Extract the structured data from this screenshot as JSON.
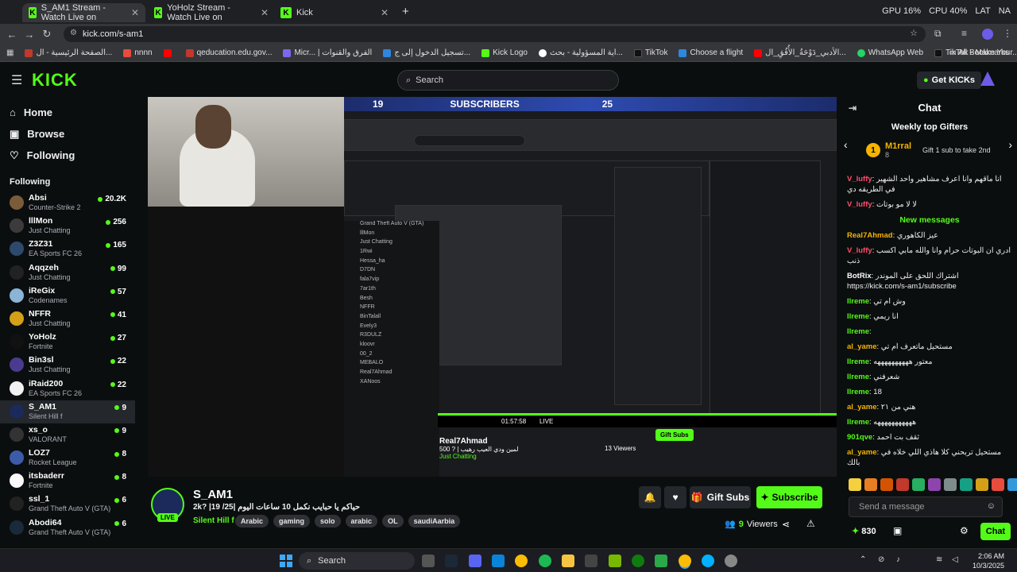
{
  "browser": {
    "tabs": [
      {
        "title": "S_AM1 Stream - Watch Live on",
        "active": true
      },
      {
        "title": "YoHolz Stream - Watch Live on",
        "active": false
      },
      {
        "title": "Kick",
        "active": false
      }
    ],
    "new_tab": "+",
    "stats": {
      "gpu": "GPU 16%",
      "cpu": "CPU 40%",
      "lang": "LAT",
      "net": "NA"
    },
    "url": "kick.com/s-am1",
    "bookmarks": [
      {
        "label": "الصفحة الرئيسية - ال...",
        "color": "#c0392b"
      },
      {
        "label": "nnnn",
        "color": "#e74c3c"
      },
      {
        "label": "",
        "color": "#ff0000"
      },
      {
        "label": "qeducation.edu.gov...",
        "color": "#c0392b"
      },
      {
        "label": "Micr... | الفرق والقنوات",
        "color": "#7b68ee"
      },
      {
        "label": "تسجيل الدخول إلى ج...",
        "color": "#2e86de"
      },
      {
        "label": "Kick Logo",
        "color": "#53fc18"
      },
      {
        "label": "اية المسؤولية - بحث...",
        "color": "#ffffff"
      },
      {
        "label": "TikTok",
        "color": "#111111"
      },
      {
        "label": "Choose a flight",
        "color": "#2e86de"
      },
      {
        "label": "الأدبي_دَوْحَةُ_الأُفُقِ_ال...",
        "color": "#ff0000"
      },
      {
        "label": "WhatsApp Web",
        "color": "#25d366"
      },
      {
        "label": "TikTok - Make Your...",
        "color": "#111111"
      },
      {
        "label": "",
        "color": "#ff0000"
      }
    ],
    "all_bookmarks": "All Bookmarks"
  },
  "kick": {
    "logo": "KICK",
    "search_placeholder": "Search",
    "get_kicks": "Get KICKs"
  },
  "sidebar": {
    "nav": [
      {
        "label": "Home",
        "icon": "home-icon"
      },
      {
        "label": "Browse",
        "icon": "browse-icon"
      },
      {
        "label": "Following",
        "icon": "heart-icon"
      }
    ],
    "following_title": "Following",
    "channels": [
      {
        "name": "Absi",
        "game": "Counter-Strike 2",
        "viewers": "20.2K",
        "color": "#7a5c3a"
      },
      {
        "name": "lllMon",
        "game": "Just Chatting",
        "viewers": "256",
        "color": "#3b3b3b"
      },
      {
        "name": "Z3Z31",
        "game": "EA Sports FC 26",
        "viewers": "165",
        "color": "#2d4a6d"
      },
      {
        "name": "Aqqzeh",
        "game": "Just Chatting",
        "viewers": "99",
        "color": "#222"
      },
      {
        "name": "iReGix",
        "game": "Codenames",
        "viewers": "57",
        "color": "#8ab4d8"
      },
      {
        "name": "NFFR",
        "game": "Just Chatting",
        "viewers": "41",
        "color": "#d4a017"
      },
      {
        "name": "YoHolz",
        "game": "Fortnite",
        "viewers": "27",
        "color": "#111"
      },
      {
        "name": "Bin3sl",
        "game": "Just Chatting",
        "viewers": "22",
        "color": "#4a3b8f"
      },
      {
        "name": "iRaid200",
        "game": "EA Sports FC 26",
        "viewers": "22",
        "color": "#f2f2f2"
      },
      {
        "name": "S_AM1",
        "game": "Silent Hill f",
        "viewers": "9",
        "color": "#1b2a5a",
        "selected": true
      },
      {
        "name": "xs_o",
        "game": "VALORANT",
        "viewers": "9",
        "color": "#333"
      },
      {
        "name": "LOZ7",
        "game": "Rocket League",
        "viewers": "8",
        "color": "#3c5ba8"
      },
      {
        "name": "itsbaderr",
        "game": "Fortnite",
        "viewers": "8",
        "color": "#fafafa"
      },
      {
        "name": "ssl_1",
        "game": "Grand Theft Auto V (GTA)",
        "viewers": "6",
        "color": "#222"
      },
      {
        "name": "Abodi64",
        "game": "Grand Theft Auto V (GTA)",
        "viewers": "6",
        "color": "#1a2a3a"
      }
    ]
  },
  "video": {
    "sub_banner_left": "19",
    "sub_banner_title": "SUBSCRIBERS",
    "sub_banner_right": "25",
    "inner_list": [
      "Grand Theft Auto V (GTA)",
      "lllMon",
      "Just Chatting",
      "1Rwi",
      "Hessa_ha",
      "D7DN",
      "fala7vip",
      "7ar1th",
      "Besh",
      "NFFR",
      "BinTalall",
      "Evely3",
      "R3DULZ",
      "kloovr",
      "00_2",
      "MEBALO",
      "Real7Ahmad",
      "XANoos"
    ],
    "inner_streamer": "Real7Ahmad",
    "inner_title": "500 ? | لمين ودي العيب رهيب",
    "inner_game": "Just Chatting",
    "inner_viewers": "13 Viewers",
    "inner_time": "01:57:58",
    "inner_live": "LIVE",
    "inner_gift": "Gift Subs"
  },
  "stream": {
    "channel": "S_AM1",
    "title": "2k? |19 /25| حياكم يا حبايب نكمل 10 ساعات اليوم",
    "game": "Silent Hill f",
    "live": "LIVE",
    "tags": [
      "Arabic",
      "gaming",
      "solo",
      "arabic",
      "OL",
      "saudiAarbia"
    ],
    "gift_subs": "Gift Subs",
    "subscribe": "Subscribe",
    "viewers_count": "9",
    "viewers_label": "Viewers"
  },
  "chat": {
    "title": "Chat",
    "weekly_title": "Weekly top Gifters",
    "top_gifter": {
      "rank": "1",
      "name": "M1rral",
      "count": "8"
    },
    "gift_prompt": "Gift 1 sub to take 2nd",
    "messages_top": [
      {
        "user": "V_luffy",
        "text": "انا ماقهم وانا اعرف مشاهير واحد الشهير في الطريقه دي",
        "color": "#ff4d6d"
      },
      {
        "user": "V_luffy",
        "text": "لا لا مو بوتات",
        "color": "#ff4d6d"
      }
    ],
    "new_messages": "New messages",
    "messages": [
      {
        "user": "Real7Ahmad",
        "text": "عيز الكاهوري",
        "color": "#f4b400"
      },
      {
        "user": "V_luffy",
        "text": "ادري ان البوتات حرام وانا والله مابي اكسب ذنب",
        "color": "#ff4d6d"
      },
      {
        "user": "BotRix",
        "text": "اشتراك اللحق على الموندر https://kick.com/s-am1/subscribe",
        "color": "#ffffff"
      },
      {
        "user": "llreme",
        "text": "وش ام تي",
        "color": "#53fc18"
      },
      {
        "user": "llreme",
        "text": "انا ريمي",
        "color": "#53fc18"
      },
      {
        "user": "llreme",
        "text": "",
        "color": "#53fc18"
      },
      {
        "user": "al_yame",
        "text": "مستحيل ماتعرف ام تي",
        "color": "#f4b400"
      },
      {
        "user": "llreme",
        "text": "معتور ههههههههههه",
        "color": "#53fc18"
      },
      {
        "user": "llreme",
        "text": "شعرفني",
        "color": "#53fc18"
      },
      {
        "user": "llreme",
        "text": "18",
        "color": "#53fc18"
      },
      {
        "user": "al_yame",
        "text": "هني من ٢١",
        "color": "#f4b400"
      },
      {
        "user": "llreme",
        "text": "هههههههههههه",
        "color": "#53fc18"
      },
      {
        "user": "901qve",
        "text": "ثقف بت احمد",
        "color": "#53fc18"
      },
      {
        "user": "al_yame",
        "text": "مستحيل تربحني كلا هاذي اللي خلاه في بالك",
        "color": "#f4b400"
      }
    ],
    "input_placeholder": "Send a message",
    "points": "830",
    "send": "Chat"
  },
  "taskbar": {
    "search": "Search",
    "time": "2:06 AM",
    "date": "10/3/2025"
  }
}
